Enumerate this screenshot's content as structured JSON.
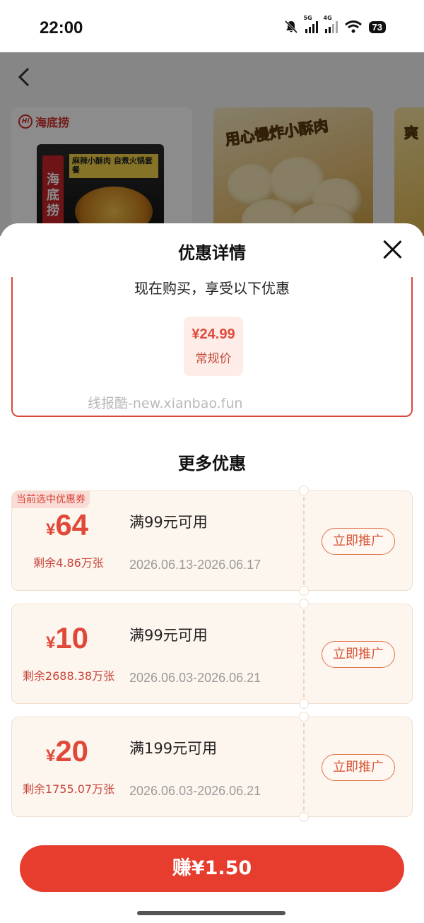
{
  "status_bar": {
    "time": "22:00",
    "net1": "5G",
    "net2": "4G",
    "battery": "73"
  },
  "background": {
    "brand_name": "海底捞",
    "brand_logo": "Hi",
    "card1_pack_brand": "海底捞",
    "card1_pack_title": "麻辣小酥肉 自煮火锅套餐",
    "card2_caption": "用心慢炸小酥肉",
    "card3_caption": "爽"
  },
  "sheet": {
    "title": "优惠详情",
    "offer_subtitle": "现在购买，享受以下优惠",
    "price_value": "¥24.99",
    "price_label": "常规价",
    "watermark": "线报酷-new.xianbao.fun",
    "more_title": "更多优惠"
  },
  "coupons": [
    {
      "badge": "当前选中优惠券",
      "currency": "¥",
      "amount": "64",
      "remaining": "剩余4.86万张",
      "condition": "满99元可用",
      "dates": "2026.06.13-2026.06.17",
      "button": "立即推广"
    },
    {
      "currency": "¥",
      "amount": "10",
      "remaining": "剩余2688.38万张",
      "condition": "满99元可用",
      "dates": "2026.06.03-2026.06.21",
      "button": "立即推广"
    },
    {
      "currency": "¥",
      "amount": "20",
      "remaining": "剩余1755.07万张",
      "condition": "满199元可用",
      "dates": "2026.06.03-2026.06.21",
      "button": "立即推广"
    }
  ],
  "footer": {
    "earn_button": "赚¥1.50"
  },
  "colors": {
    "accent": "#e63d2e",
    "price_red": "#e0483a",
    "coupon_bg": "#fdf6ef"
  }
}
